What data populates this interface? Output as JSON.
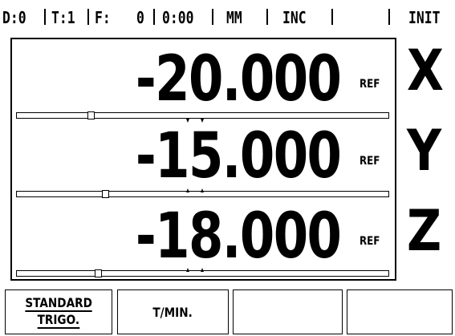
{
  "status_bar": {
    "datum": "D:0",
    "tool": "T:1",
    "feed_label": "F:",
    "feed_value": "0",
    "time": "0:00",
    "units": "MM",
    "mode": "INC",
    "blank": "",
    "state": "INIT"
  },
  "axes": [
    {
      "letter": "X",
      "value": "-20.000",
      "ref": "REF",
      "dtg_fraction": 0.19
    },
    {
      "letter": "Y",
      "value": "-15.000",
      "ref": "REF",
      "dtg_fraction": 0.23
    },
    {
      "letter": "Z",
      "value": "-18.000",
      "ref": "REF",
      "dtg_fraction": 0.21
    }
  ],
  "softkeys": [
    {
      "line1": "STANDARD",
      "line2": "TRIGO."
    },
    {
      "line1": "T/MIN.",
      "line2": ""
    },
    {
      "line1": "",
      "line2": ""
    },
    {
      "line1": "",
      "line2": ""
    }
  ],
  "colors": {
    "background": "#ffffff",
    "foreground": "#000000"
  }
}
